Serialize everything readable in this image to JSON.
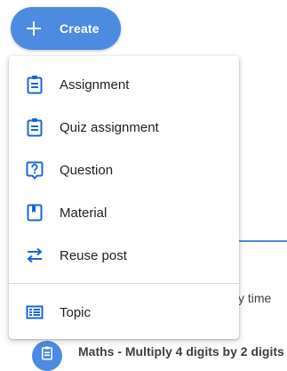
{
  "create_button": {
    "label": "Create"
  },
  "menu": {
    "items": [
      {
        "label": "Assignment",
        "icon": "assignment-icon"
      },
      {
        "label": "Quiz assignment",
        "icon": "quiz-assignment-icon"
      },
      {
        "label": "Question",
        "icon": "question-icon"
      },
      {
        "label": "Material",
        "icon": "material-icon"
      },
      {
        "label": "Reuse post",
        "icon": "reuse-post-icon"
      }
    ],
    "topic": {
      "label": "Topic",
      "icon": "topic-icon"
    }
  },
  "background": {
    "partial_text": "y time",
    "post_title": "Maths - Multiply 4 digits by 2 digits"
  },
  "colors": {
    "accent": "#4c8be0",
    "icon_blue": "#1967d2"
  }
}
